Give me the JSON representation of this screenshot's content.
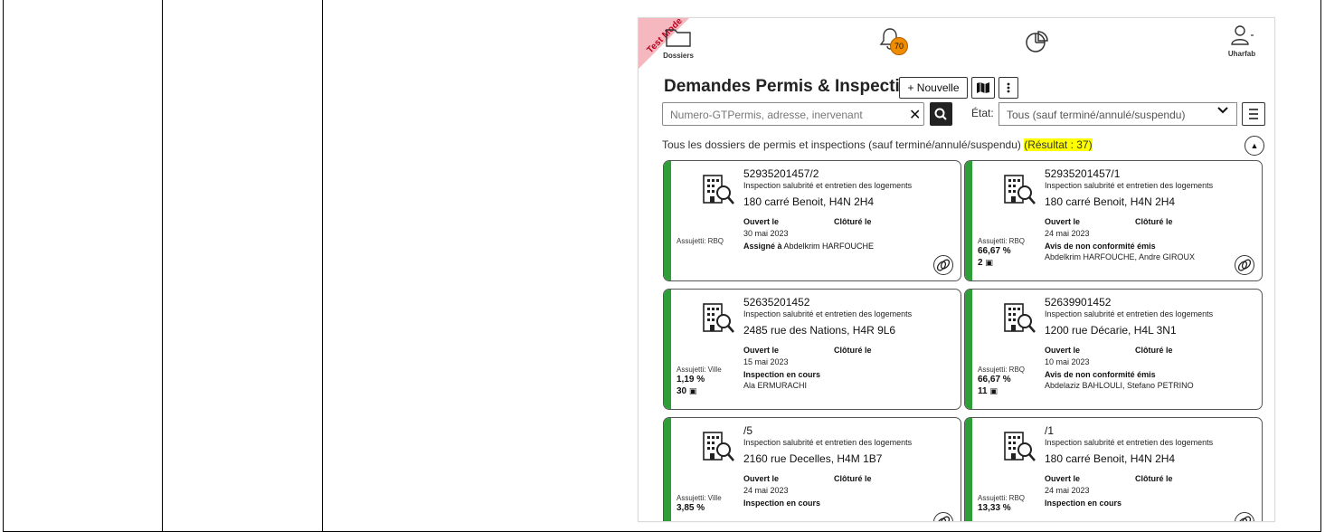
{
  "app": {
    "ribbon_text": "Test Mode",
    "nav": {
      "dossiers_label": "Dossiers",
      "notifications_count": "70",
      "user_label": "Uharfab"
    },
    "title": "Demandes Permis & Inspections",
    "buttons": {
      "new_label": "+ Nouvelle"
    },
    "search": {
      "placeholder": "Numero-GTPermis, adresse, inervenant"
    },
    "filter": {
      "label": "État:",
      "value": "Tous (sauf terminé/annulé/suspendu)"
    },
    "summary": {
      "text": "Tous les dossiers de permis et inspections (sauf terminé/annulé/suspendu) ",
      "result": "(Résultat : 37)"
    },
    "labels": {
      "opened": "Ouvert le",
      "closed": "Clôturé le"
    },
    "cards": [
      {
        "number": "52935201457/2",
        "type": "Inspection salubrité et entretien des logements",
        "address": "180 carré Benoit, H4N 2H4",
        "opened": "30 mai 2023",
        "status": "Assigné à",
        "names": "Abdelkrim HARFOUCHE",
        "assujetti": "Assujetti: RBQ",
        "percent": "",
        "photos": ""
      },
      {
        "number": "52935201457/1",
        "type": "Inspection salubrité et entretien des logements",
        "address": "180 carré Benoit, H4N 2H4",
        "opened": "24 mai 2023",
        "status": "Avis de non conformité émis",
        "names": "Abdelkrim HARFOUCHE, Andre GIROUX",
        "assujetti": "Assujetti: RBQ",
        "percent": "66,67 %",
        "photos": "2"
      },
      {
        "number": "52635201452",
        "type": "Inspection salubrité et entretien des logements",
        "address": "2485 rue des Nations, H4R 9L6",
        "opened": "15 mai 2023",
        "status": "Inspection en cours",
        "names": "Ala ERMURACHI",
        "assujetti": "Assujetti: Ville",
        "percent": "1,19 %",
        "photos": "30"
      },
      {
        "number": "52639901452",
        "type": "Inspection salubrité et entretien des logements",
        "address": "1200 rue Décarie, H4L 3N1",
        "opened": "10 mai 2023",
        "status": "Avis de non conformité émis",
        "names": "Abdelaziz BAHLOULI, Stefano PETRINO",
        "assujetti": "Assujetti: RBQ",
        "percent": "66,67 %",
        "photos": "11"
      },
      {
        "number": "/5",
        "type": "Inspection salubrité et entretien des logements",
        "address": "2160 rue Decelles, H4M 1B7",
        "opened": "24 mai 2023",
        "status": "Inspection en cours",
        "names": "",
        "assujetti": "Assujetti: Ville",
        "percent": "3,85 %",
        "photos": ""
      },
      {
        "number": "/1",
        "type": "Inspection salubrité et entretien des logements",
        "address": "180 carré Benoit, H4N 2H4",
        "opened": "24 mai 2023",
        "status": "Inspection en cours",
        "names": "",
        "assujetti": "Assujetti: RBQ",
        "percent": "13,33 %",
        "photos": ""
      }
    ]
  }
}
